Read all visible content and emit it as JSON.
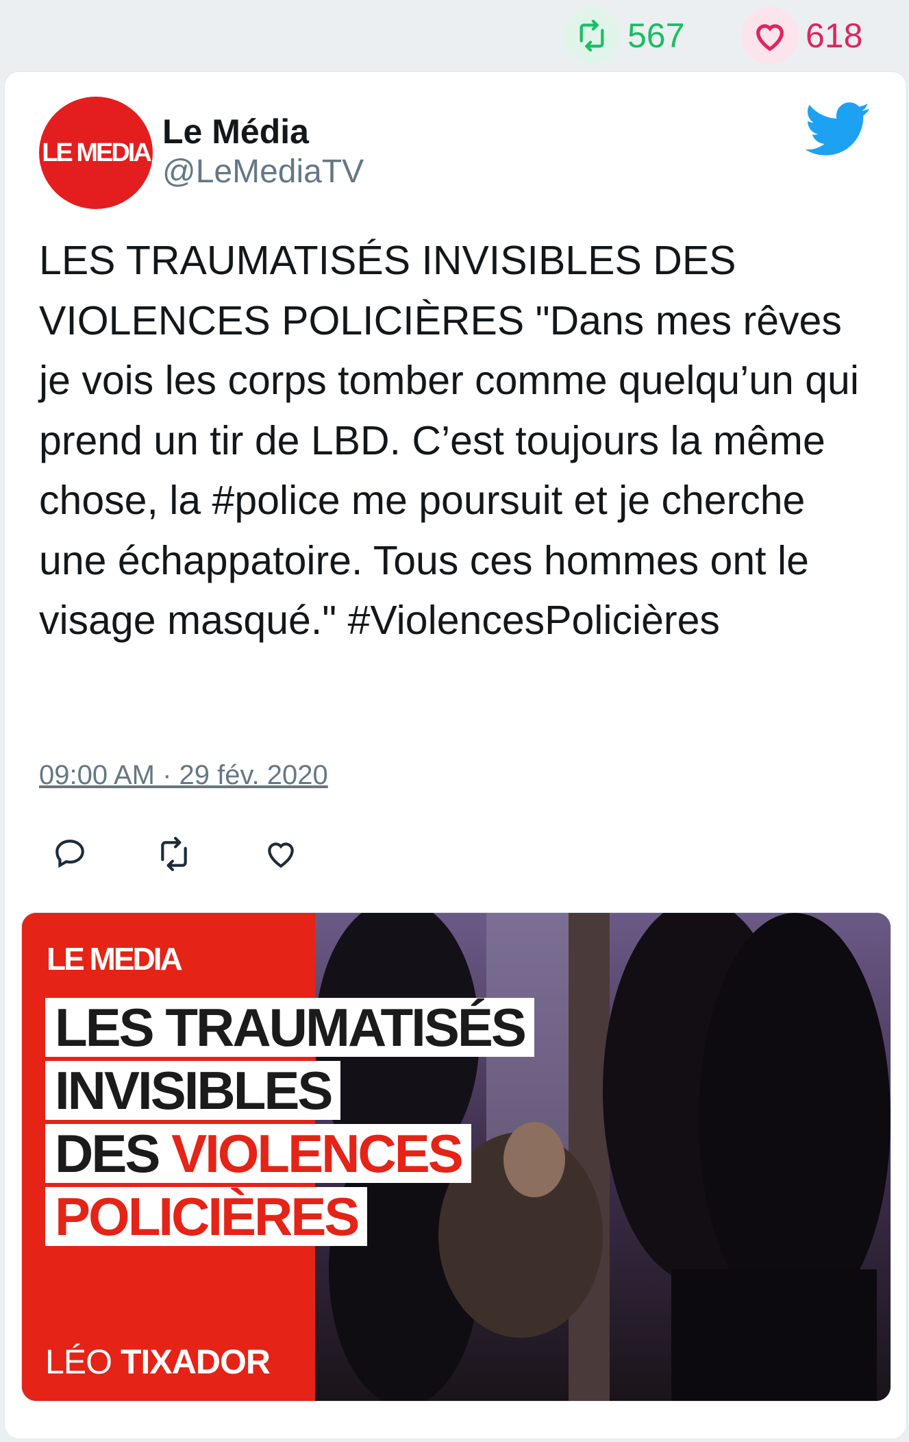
{
  "stats": {
    "retweets": "567",
    "likes": "618",
    "retweet_icon": "retweet-icon",
    "like_icon": "heart-icon"
  },
  "tweet": {
    "author_name": "Le Média",
    "author_handle": "@LeMediaTV",
    "avatar_logo": "LE MEDIA",
    "text": "LES TRAUMATISÉS INVISIBLES DES VIOLENCES POLICIÈRES \"Dans mes rêves je vois les corps tomber comme quelqu’un qui prend un tir de LBD. C’est toujours la même chose, la #police me poursuit et je cherche une échappatoire. Tous ces hommes ont le visage masqué.\" #ViolencesPolicières",
    "timestamp": "09:00 AM · 29 fév. 2020"
  },
  "actions": [
    "reply-icon",
    "retweet-icon",
    "like-icon"
  ],
  "media": {
    "logo": "LE MEDIA",
    "headline": {
      "line1": "LES TRAUMATISÉS",
      "line2": "INVISIBLES",
      "line3_black": "DES ",
      "line3_red": "VIOLENCES",
      "line4": "POLICIÈRES"
    },
    "author_first": "LÉO ",
    "author_last": "TIXADOR"
  },
  "colors": {
    "retweet_green": "#17bf63",
    "like_red": "#e0245e",
    "twitter_blue": "#1da1f2",
    "brand_red": "#e52317",
    "text": "#14171a",
    "secondary_text": "#657786"
  }
}
